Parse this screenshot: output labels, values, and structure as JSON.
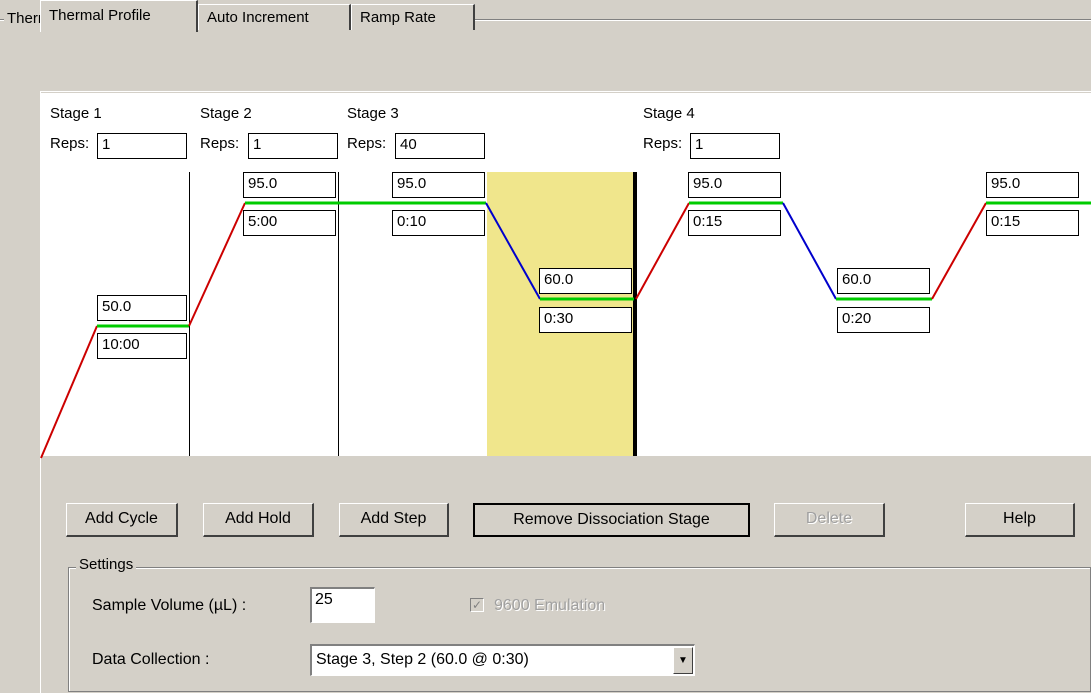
{
  "group": {
    "title": "Thermal Cycler Protocol"
  },
  "tabs": [
    {
      "label": "Thermal Profile",
      "active": true
    },
    {
      "label": "Auto Increment",
      "active": false
    },
    {
      "label": "Ramp Rate",
      "active": false
    }
  ],
  "stages": [
    {
      "label": "Stage 1",
      "reps_label": "Reps:",
      "reps": "1"
    },
    {
      "label": "Stage 2",
      "reps_label": "Reps:",
      "reps": "1"
    },
    {
      "label": "Stage 3",
      "reps_label": "Reps:",
      "reps": "40"
    },
    {
      "label": "Stage 4",
      "reps_label": "Reps:",
      "reps": "1"
    }
  ],
  "steps": [
    {
      "temp": "50.0",
      "time": "10:00"
    },
    {
      "temp": "95.0",
      "time": "5:00"
    },
    {
      "temp": "95.0",
      "time": "0:10"
    },
    {
      "temp": "60.0",
      "time": "0:30"
    },
    {
      "temp": "95.0",
      "time": "0:15"
    },
    {
      "temp": "60.0",
      "time": "0:20"
    },
    {
      "temp": "95.0",
      "time": "0:15"
    }
  ],
  "buttons": {
    "add_cycle": "Add Cycle",
    "add_hold": "Add Hold",
    "add_step": "Add Step",
    "remove_dissociation": "Remove Dissociation Stage",
    "delete": "Delete",
    "help": "Help"
  },
  "settings": {
    "title": "Settings",
    "sample_volume_label": "Sample Volume (µL) :",
    "sample_volume": "25",
    "emulation_label": "9600 Emulation",
    "emulation_checked": true,
    "data_collection_label": "Data Collection :",
    "data_collection_value": "Stage 3, Step 2 (60.0 @ 0:30)"
  },
  "colors": {
    "ramp_up": "#cc0000",
    "ramp_down": "#0000cc",
    "hold": "#00cc00",
    "highlight": "#f0e68c"
  }
}
